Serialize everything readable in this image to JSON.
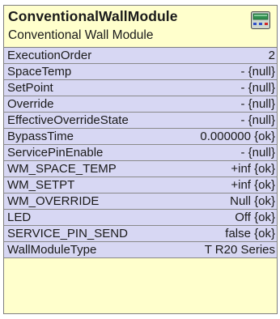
{
  "module": {
    "title": "ConventionalWallModule",
    "subtitle": "Conventional Wall Module",
    "icon": "wall-module-icon"
  },
  "colors": {
    "header_bg": "#ffffcc",
    "row_bg": "#d7d7f3",
    "border": "#7f7f7f"
  },
  "properties": [
    {
      "name": "ExecutionOrder",
      "value": "2"
    },
    {
      "name": "SpaceTemp",
      "value": "- {null}"
    },
    {
      "name": "SetPoint",
      "value": "- {null}"
    },
    {
      "name": "Override",
      "value": "- {null}"
    },
    {
      "name": "EffectiveOverrideState",
      "value": "- {null}"
    },
    {
      "name": "BypassTime",
      "value": "0.000000 {ok}"
    },
    {
      "name": "ServicePinEnable",
      "value": "- {null}"
    },
    {
      "name": "WM_SPACE_TEMP",
      "value": "+inf {ok}"
    },
    {
      "name": "WM_SETPT",
      "value": "+inf {ok}"
    },
    {
      "name": "WM_OVERRIDE",
      "value": "Null {ok}"
    },
    {
      "name": "LED",
      "value": "Off {ok}"
    },
    {
      "name": "SERVICE_PIN_SEND",
      "value": "false {ok}"
    },
    {
      "name": "WallModuleType",
      "value": "T R20 Series"
    }
  ]
}
